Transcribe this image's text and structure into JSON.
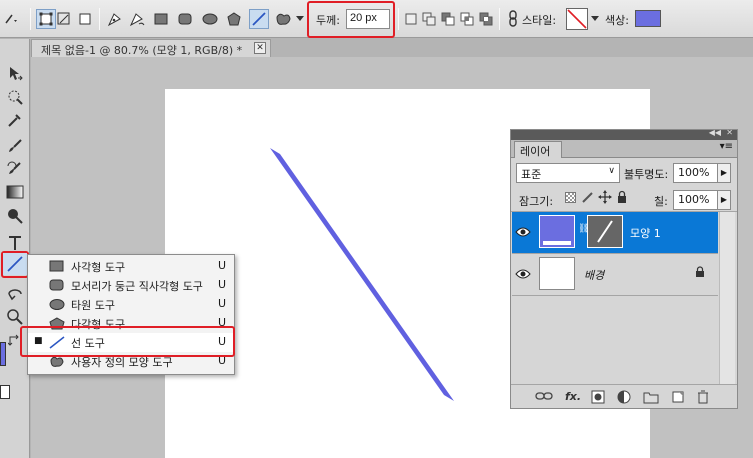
{
  "options_bar": {
    "thickness_label": "두께:",
    "thickness_value": "20 px",
    "style_label": "스타일:",
    "color_label": "색상:",
    "color_value": "#6b6ee0"
  },
  "document": {
    "tab_title": "제목 없음-1 @ 80.7% (모양 1, RGB/8) *",
    "close_glyph": "✕",
    "line_color": "#6060e0"
  },
  "tool_menu": {
    "items": [
      {
        "label": "사각형 도구",
        "shortcut": "U",
        "icon": "rectangle-icon",
        "active": false
      },
      {
        "label": "모서리가 둥근 직사각형 도구",
        "shortcut": "U",
        "icon": "rounded-rectangle-icon",
        "active": false
      },
      {
        "label": "타원 도구",
        "shortcut": "U",
        "icon": "ellipse-icon",
        "active": false
      },
      {
        "label": "다각형 도구",
        "shortcut": "U",
        "icon": "polygon-icon",
        "active": false
      },
      {
        "label": "선 도구",
        "shortcut": "U",
        "icon": "line-icon",
        "active": true
      },
      {
        "label": "사용자 정의 모양 도구",
        "shortcut": "U",
        "icon": "custom-shape-icon",
        "active": false
      }
    ]
  },
  "layers_panel": {
    "tab_label": "레이어",
    "blend_mode": "표준",
    "opacity_label": "불투명도:",
    "opacity_value": "100%",
    "lock_label": "잠그기:",
    "fill_label": "칠:",
    "fill_value": "100%",
    "layers": [
      {
        "name": "모양 1",
        "selected": true
      },
      {
        "name": "배경",
        "selected": false,
        "locked": true
      }
    ]
  },
  "accent_highlight": "#e01e26",
  "selection_blue": "#0a78d6"
}
